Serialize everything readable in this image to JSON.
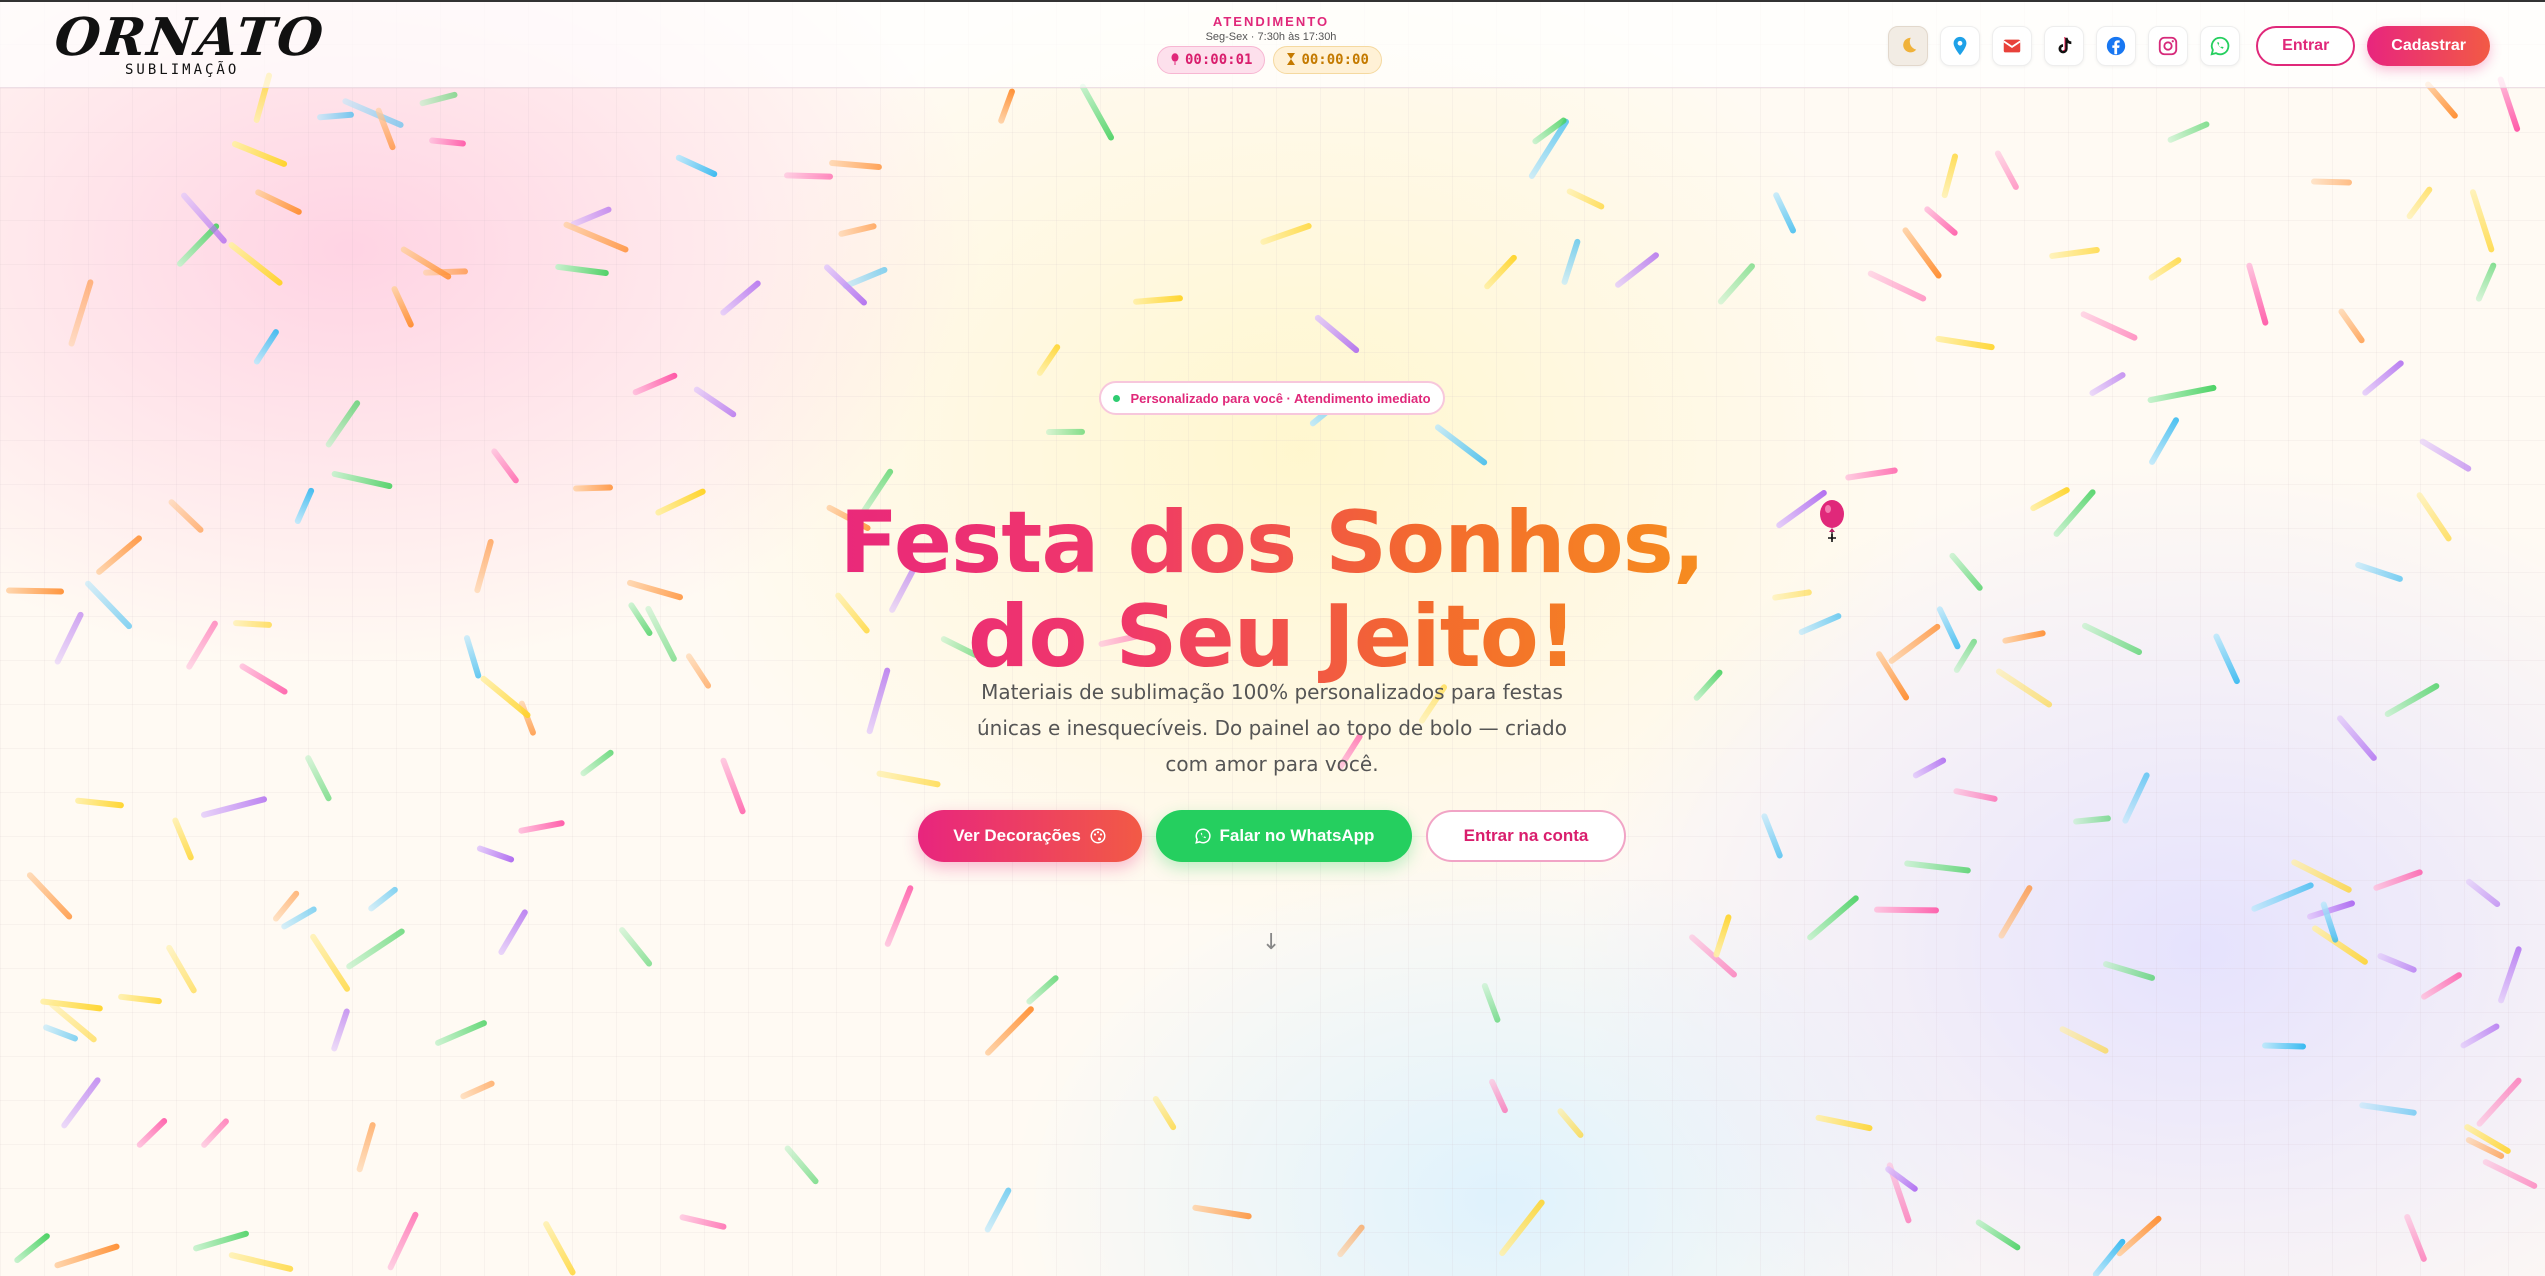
{
  "brand": {
    "logo_main": "ORNATO",
    "logo_sub": "SUBLIMAÇÃO"
  },
  "header": {
    "atendimento_title": "ATENDIMENTO",
    "atendimento_hours": "Seg-Sex · 7:30h às 17:30h",
    "timer_1": "00:00:01",
    "timer_2": "00:00:00",
    "icons": [
      "moon-icon",
      "map-pin-icon",
      "mail-icon",
      "tiktok-icon",
      "facebook-icon",
      "instagram-icon",
      "whatsapp-icon"
    ],
    "login_label": "Entrar",
    "signup_label": "Cadastrar"
  },
  "hero": {
    "badge": "Personalizado para você · Atendimento imediato",
    "title_line_1": "Festa dos Sonhos,",
    "title_line_2": "do Seu Jeito!",
    "subtitle": "Materiais de sublimação 100% personalizados para festas únicas e inesquecíveis. Do painel ao topo de bolo — criado com amor para você.",
    "cta_primary": "Ver Decorações",
    "cta_whatsapp": "Falar no WhatsApp",
    "cta_account": "Entrar na conta",
    "scroll_hint": "↓"
  },
  "colors": {
    "brand_pink": "#e8257e",
    "brand_orange": "#f25a45",
    "whatsapp_green": "#25cf5f"
  }
}
